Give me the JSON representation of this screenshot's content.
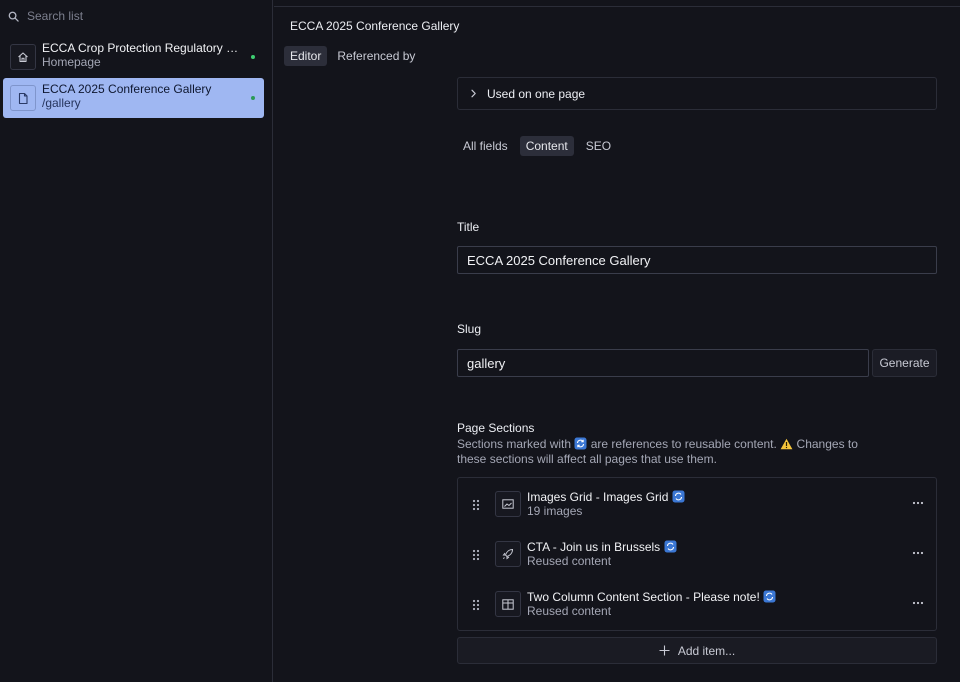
{
  "sidebar": {
    "search_placeholder": "Search list",
    "items": [
      {
        "title": "ECCA Crop Protection Regulatory Con...",
        "subtitle": "Homepage",
        "icon": "home-icon"
      },
      {
        "title": "ECCA 2025 Conference Gallery",
        "subtitle": "/gallery",
        "icon": "document-icon"
      }
    ]
  },
  "header": {
    "title": "ECCA 2025 Conference Gallery",
    "tabs": [
      "Editor",
      "Referenced by"
    ]
  },
  "references": {
    "label": "Used on one page"
  },
  "field_tabs": [
    "All fields",
    "Content",
    "SEO"
  ],
  "fields": {
    "title": {
      "label": "Title",
      "value": "ECCA 2025 Conference Gallery"
    },
    "slug": {
      "label": "Slug",
      "value": "gallery",
      "generate_label": "Generate"
    }
  },
  "sections": {
    "label": "Page Sections",
    "desc_part1": "Sections marked with",
    "desc_part2": "are references to reusable content.",
    "desc_part3": "Changes to these sections will affect all pages that use them.",
    "items": [
      {
        "title": "Images Grid - Images Grid",
        "subtitle": "19 images",
        "icon": "image-icon"
      },
      {
        "title": "CTA - Join us in Brussels",
        "subtitle": "Reused content",
        "icon": "rocket-icon"
      },
      {
        "title": "Two Column Content Section - Please note!",
        "subtitle": "Reused content",
        "icon": "columns-icon"
      }
    ],
    "add_label": "Add item..."
  },
  "colors": {
    "background": "#13141b",
    "selected": "#9fb7f2",
    "status_green": "#3ecf72",
    "border": "#2b2d38"
  }
}
